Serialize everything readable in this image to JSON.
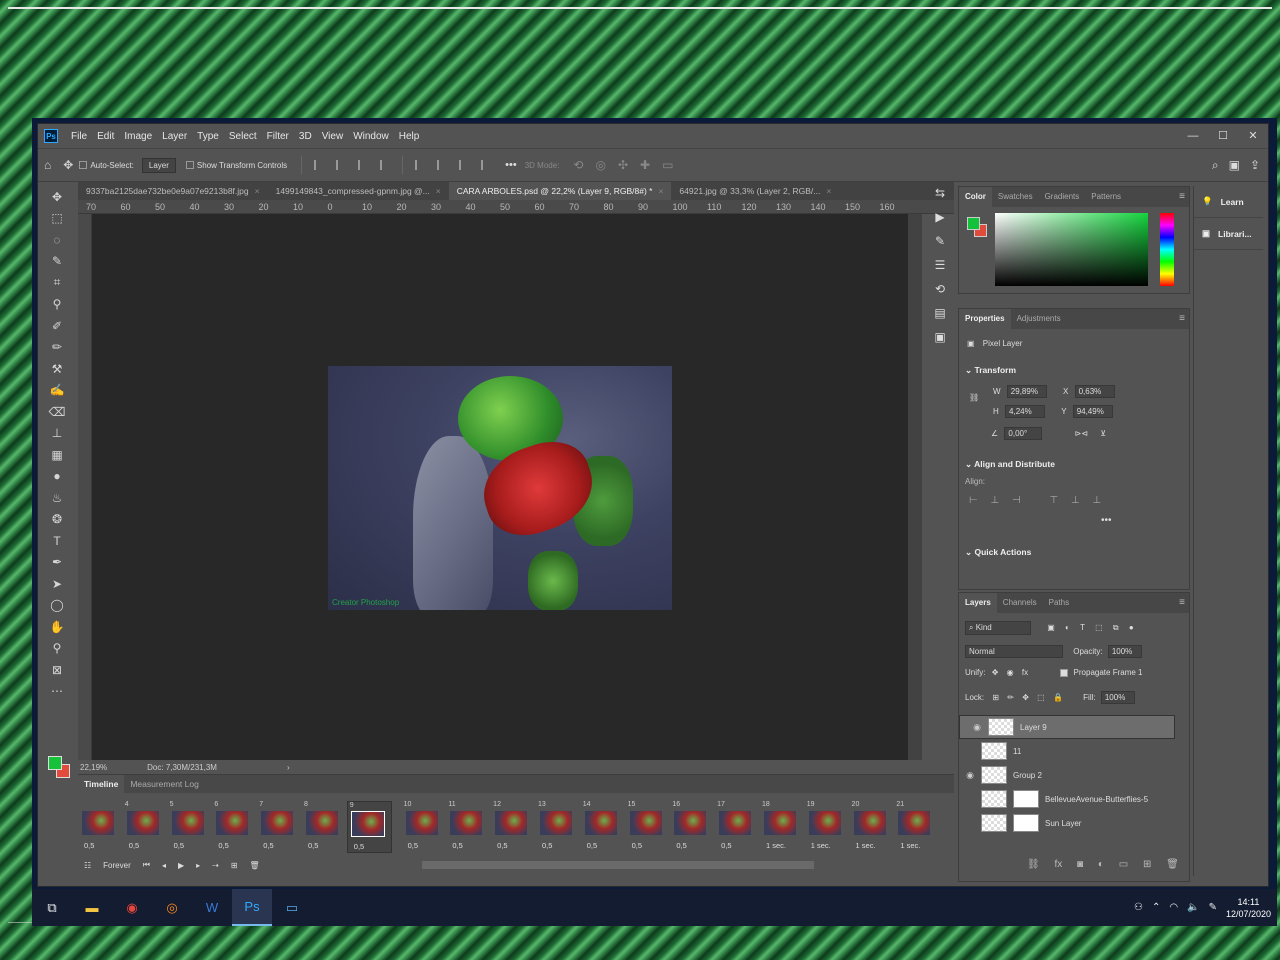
{
  "menubar": {
    "app_logo": "Ps",
    "items": [
      "File",
      "Edit",
      "Image",
      "Layer",
      "Type",
      "Select",
      "Filter",
      "3D",
      "View",
      "Window",
      "Help"
    ],
    "window_controls": [
      "—",
      "☐",
      "✕"
    ]
  },
  "options": {
    "auto_select_label": "Auto-Select:",
    "auto_select_target": "Layer",
    "show_transform_label": "Show Transform Controls",
    "mode_3d_label": "3D Mode:",
    "more_label": "•••"
  },
  "tabs": [
    {
      "label": "9337ba2125dae732be0e9a07e9213b8f.jpg",
      "active": false
    },
    {
      "label": "1499149843_compressed-gpnm.jpg @...",
      "active": false
    },
    {
      "label": "CARA ARBOLES.psd @ 22,2% (Layer 9, RGB/8#) *",
      "active": true
    },
    {
      "label": "64921.jpg @ 33,3% (Layer 2, RGB/...",
      "active": false
    }
  ],
  "ruler_ticks": [
    "70",
    "60",
    "50",
    "40",
    "30",
    "20",
    "10",
    "0",
    "10",
    "20",
    "30",
    "40",
    "50",
    "60",
    "70",
    "80",
    "90",
    "100",
    "110",
    "120",
    "130",
    "140",
    "150",
    "160"
  ],
  "artwork": {
    "watermark": "Creator Photoshop"
  },
  "status": {
    "zoom": "22,19%",
    "doc": "Doc: 7,30M/231,3M",
    "arrow": "›"
  },
  "timeline": {
    "tabs": [
      "Timeline",
      "Measurement Log"
    ],
    "frames": [
      {
        "num": "",
        "delay": "0,5"
      },
      {
        "num": "4",
        "delay": "0,5"
      },
      {
        "num": "5",
        "delay": "0,5"
      },
      {
        "num": "6",
        "delay": "0,5"
      },
      {
        "num": "7",
        "delay": "0,5"
      },
      {
        "num": "8",
        "delay": "0,5"
      },
      {
        "num": "9",
        "delay": "0,5"
      },
      {
        "num": "10",
        "delay": "0,5"
      },
      {
        "num": "11",
        "delay": "0,5"
      },
      {
        "num": "12",
        "delay": "0,5"
      },
      {
        "num": "13",
        "delay": "0,5"
      },
      {
        "num": "14",
        "delay": "0,5"
      },
      {
        "num": "15",
        "delay": "0,5"
      },
      {
        "num": "16",
        "delay": "0,5"
      },
      {
        "num": "17",
        "delay": "0,5"
      },
      {
        "num": "18",
        "delay": "1 sec."
      },
      {
        "num": "19",
        "delay": "1 sec."
      },
      {
        "num": "20",
        "delay": "1 sec."
      },
      {
        "num": "21",
        "delay": "1 sec."
      }
    ],
    "selected_frame": "9",
    "loop": "Forever"
  },
  "color_panel": {
    "tabs": [
      "Color",
      "Swatches",
      "Gradients",
      "Patterns"
    ]
  },
  "properties_panel": {
    "tabs": [
      "Properties",
      "Adjustments"
    ],
    "layer_type": "Pixel Layer",
    "transform_title": "Transform",
    "w_label": "W",
    "w": "29,89%",
    "x_label": "X",
    "x": "0,63%",
    "h_label": "H",
    "h": "4,24%",
    "y_label": "Y",
    "y": "94,49%",
    "angle": "0,00°",
    "align_title": "Align and Distribute",
    "align_label": "Align:",
    "quick_actions": "Quick Actions",
    "more": "•••"
  },
  "layers_panel": {
    "tabs": [
      "Layers",
      "Channels",
      "Paths"
    ],
    "kind": "Kind",
    "blend_mode": "Normal",
    "opacity_label": "Opacity:",
    "opacity": "100%",
    "unify_label": "Unify:",
    "propagate_label": "Propagate Frame 1",
    "lock_label": "Lock:",
    "fill_label": "Fill:",
    "fill": "100%",
    "layers": [
      {
        "name": "Layer 9",
        "visible": true,
        "selected": true
      },
      {
        "name": "11",
        "visible": false,
        "selected": false
      },
      {
        "name": "Group 2",
        "visible": true,
        "selected": false
      },
      {
        "name": "BellevueAvenue-Butterflies-5",
        "visible": false,
        "selected": false
      },
      {
        "name": "Sun Layer",
        "visible": false,
        "selected": false
      }
    ]
  },
  "right_strip": {
    "items": [
      "Learn",
      "Librari..."
    ]
  },
  "taskbar": {
    "time": "14:11",
    "date": "12/07/2020"
  },
  "colors": {
    "foreground": "#13c13a",
    "background": "#e04b3c",
    "accent": "#31a8ff"
  }
}
